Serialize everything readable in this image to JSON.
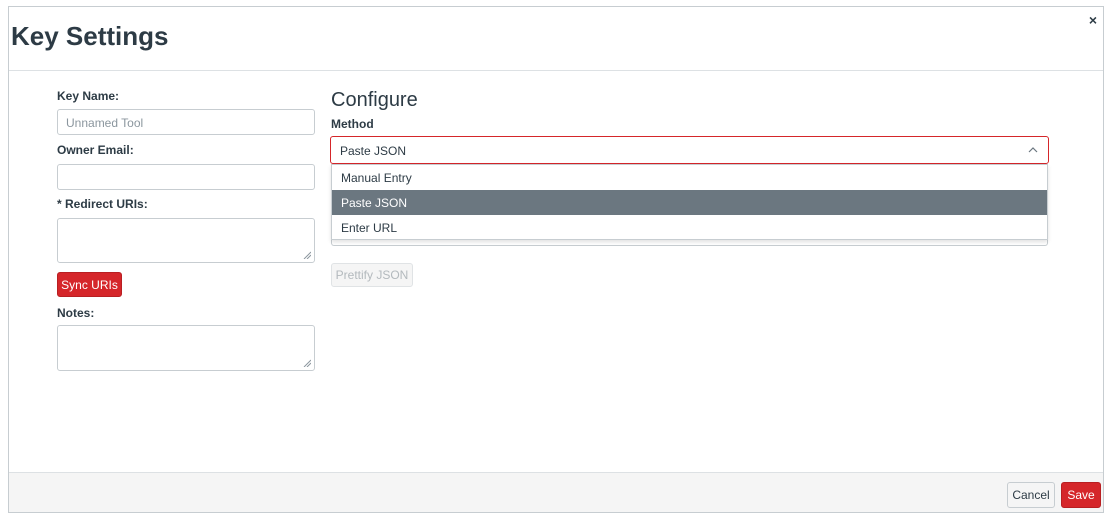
{
  "modal": {
    "title": "Key Settings",
    "close_label": "×"
  },
  "left": {
    "key_name_label": "Key Name:",
    "key_name_placeholder": "Unnamed Tool",
    "owner_email_label": "Owner Email:",
    "owner_email_value": "",
    "redirect_uris_label": "* Redirect URIs:",
    "sync_uris_label": "Sync URIs",
    "notes_label": "Notes:"
  },
  "configure": {
    "heading": "Configure",
    "method_label": "Method",
    "method_selected": "Paste JSON",
    "method_options": [
      "Manual Entry",
      "Paste JSON",
      "Enter URL"
    ],
    "prettify_label": "Prettify JSON"
  },
  "footer": {
    "cancel_label": "Cancel",
    "save_label": "Save"
  },
  "colors": {
    "accent": "#d5262a",
    "highlight": "#6b7780"
  }
}
